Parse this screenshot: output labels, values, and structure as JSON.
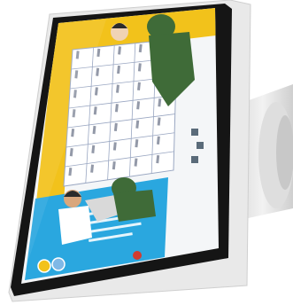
{
  "photo": {
    "subject": "tablet-kiosk-on-stand",
    "colors": {
      "background": "#ffffff",
      "bezel": "#151515",
      "frame": "#e9e9e9",
      "screen_bg": "#f4f6f8",
      "banner_yellow": "#f2c21b",
      "panel_blue": "#2aa7df",
      "table_bg": "#ffffff",
      "table_line": "#9aa7c2",
      "character_green": "#3f6b38"
    }
  },
  "screen": {
    "table": {
      "rows": 7,
      "cols": 5
    }
  }
}
